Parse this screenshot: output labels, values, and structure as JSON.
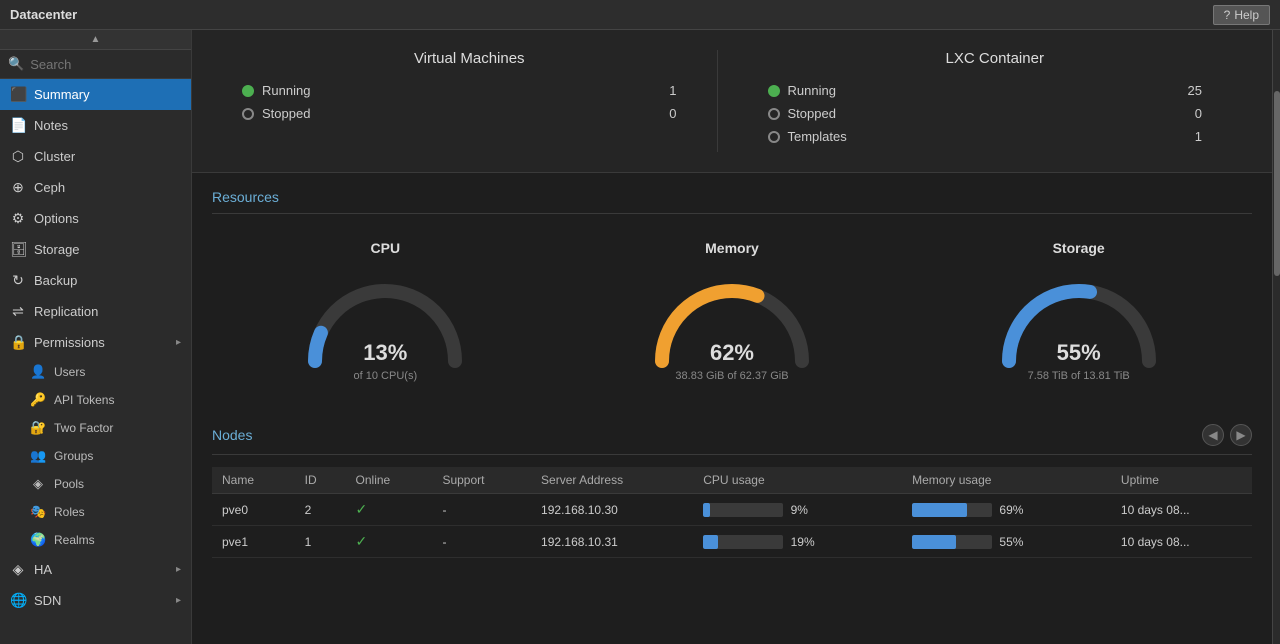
{
  "topbar": {
    "title": "Datacenter",
    "help_label": "Help"
  },
  "sidebar": {
    "search_placeholder": "Search",
    "items": [
      {
        "id": "summary",
        "label": "Summary",
        "icon": "🖥",
        "active": true
      },
      {
        "id": "notes",
        "label": "Notes",
        "icon": "📝"
      },
      {
        "id": "cluster",
        "label": "Cluster",
        "icon": "⬡"
      },
      {
        "id": "ceph",
        "label": "Ceph",
        "icon": "⊕"
      },
      {
        "id": "options",
        "label": "Options",
        "icon": "⚙"
      },
      {
        "id": "storage",
        "label": "Storage",
        "icon": "🗄"
      },
      {
        "id": "backup",
        "label": "Backup",
        "icon": "🔄"
      },
      {
        "id": "replication",
        "label": "Replication",
        "icon": "⇌"
      },
      {
        "id": "permissions",
        "label": "Permissions",
        "icon": "🔒",
        "has_chevron": true
      },
      {
        "id": "ha",
        "label": "HA",
        "icon": "◈",
        "has_chevron": true
      },
      {
        "id": "sdn",
        "label": "SDN",
        "icon": "🌐",
        "has_chevron": true
      }
    ],
    "sub_items": [
      {
        "id": "users",
        "label": "Users",
        "icon": "👤"
      },
      {
        "id": "api-tokens",
        "label": "API Tokens",
        "icon": "🔑"
      },
      {
        "id": "two-factor",
        "label": "Two Factor",
        "icon": "🔐"
      },
      {
        "id": "groups",
        "label": "Groups",
        "icon": "👥"
      },
      {
        "id": "pools",
        "label": "Pools",
        "icon": "🏊"
      },
      {
        "id": "roles",
        "label": "Roles",
        "icon": "🎭"
      },
      {
        "id": "realms",
        "label": "Realms",
        "icon": "🌍"
      }
    ]
  },
  "vm": {
    "title": "Virtual Machines",
    "running_label": "Running",
    "running_count": "1",
    "stopped_label": "Stopped",
    "stopped_count": "0"
  },
  "lxc": {
    "title": "LXC Container",
    "running_label": "Running",
    "running_count": "25",
    "stopped_label": "Stopped",
    "stopped_count": "0",
    "templates_label": "Templates",
    "templates_count": "1"
  },
  "resources": {
    "title": "Resources",
    "cpu": {
      "title": "CPU",
      "percent": 13,
      "percent_label": "13%",
      "sub_label": "of 10 CPU(s)",
      "color": "#4a90d9"
    },
    "memory": {
      "title": "Memory",
      "percent": 62,
      "percent_label": "62%",
      "sub_label": "38.83 GiB of 62.37 GiB",
      "color": "#f0a030"
    },
    "storage": {
      "title": "Storage",
      "percent": 55,
      "percent_label": "55%",
      "sub_label": "7.58 TiB of 13.81 TiB",
      "color": "#4a90d9"
    }
  },
  "nodes": {
    "title": "Nodes",
    "columns": [
      "Name",
      "ID",
      "Online",
      "Support",
      "Server Address",
      "CPU usage",
      "Memory usage",
      "Uptime"
    ],
    "rows": [
      {
        "name": "pve0",
        "id": "2",
        "online": true,
        "support": "-",
        "address": "192.168.10.30",
        "cpu_pct": 9,
        "cpu_label": "9%",
        "mem_pct": 69,
        "mem_label": "69%",
        "uptime": "10 days 08..."
      },
      {
        "name": "pve1",
        "id": "1",
        "online": true,
        "support": "-",
        "address": "192.168.10.31",
        "cpu_pct": 19,
        "cpu_label": "19%",
        "mem_pct": 55,
        "mem_label": "55%",
        "uptime": "10 days 08..."
      }
    ]
  },
  "colors": {
    "cpu_bar": "#4a90d9",
    "mem_bar": "#4a90d9",
    "sidebar_active": "#1e6fb5"
  }
}
